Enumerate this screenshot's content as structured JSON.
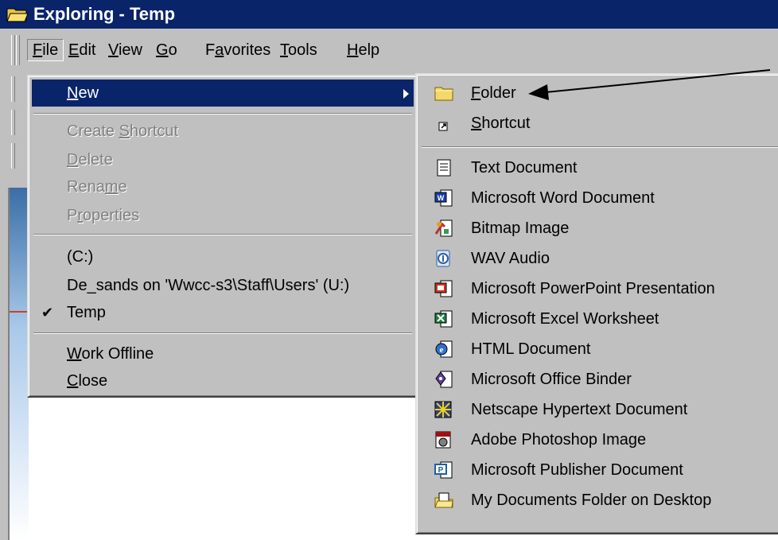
{
  "window": {
    "title": "Exploring - Temp"
  },
  "menubar": {
    "items": [
      {
        "pre": "",
        "key": "F",
        "post": "ile"
      },
      {
        "pre": "",
        "key": "E",
        "post": "dit"
      },
      {
        "pre": "",
        "key": "V",
        "post": "iew"
      },
      {
        "pre": "",
        "key": "G",
        "post": "o"
      },
      {
        "pre": "F",
        "key": "a",
        "post": "vorites"
      },
      {
        "pre": "",
        "key": "T",
        "post": "ools"
      },
      {
        "pre": "",
        "key": "H",
        "post": "elp"
      }
    ]
  },
  "file_menu": {
    "new": {
      "pre": "",
      "key": "N",
      "post": "ew"
    },
    "create_shortcut": {
      "pre": "Create ",
      "key": "S",
      "post": "hortcut"
    },
    "delete": {
      "pre": "",
      "key": "D",
      "post": "elete"
    },
    "rename": {
      "pre": "Rena",
      "key": "m",
      "post": "e"
    },
    "properties": {
      "pre": "P",
      "key": "r",
      "post": "operties"
    },
    "drive_c": "(C:)",
    "drive_u": "De_sands on 'Wwcc-s3\\Staff\\Users' (U:)",
    "temp": "Temp",
    "temp_check": "✔",
    "work_offline": {
      "pre": "",
      "key": "W",
      "post": "ork Offline"
    },
    "close": {
      "pre": "",
      "key": "C",
      "post": "lose"
    }
  },
  "new_menu": {
    "folder": {
      "pre": "",
      "key": "F",
      "post": "older"
    },
    "shortcut": {
      "pre": "",
      "key": "S",
      "post": "hortcut"
    },
    "items": [
      "Text Document",
      "Microsoft Word Document",
      "Bitmap Image",
      "WAV Audio",
      "Microsoft PowerPoint Presentation",
      "Microsoft Excel Worksheet",
      "HTML Document",
      "Microsoft Office Binder",
      "Netscape Hypertext Document",
      "Adobe Photoshop Image",
      "Microsoft Publisher Document",
      "My Documents Folder on Desktop"
    ]
  },
  "colors": {
    "title_bar": "#0a246a",
    "menu_face": "#c0c0c0",
    "highlight": "#0a246a",
    "disabled_text": "#808080"
  }
}
